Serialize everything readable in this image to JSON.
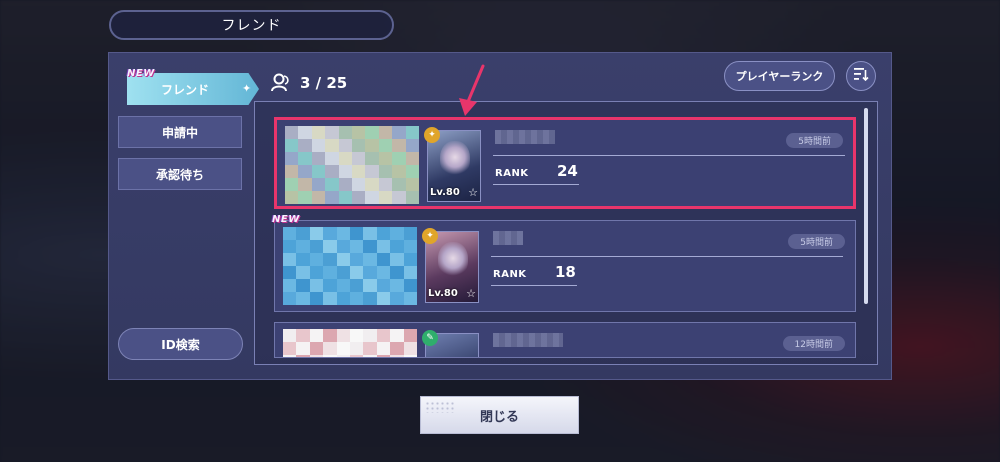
{
  "header": {
    "title": "フレンド"
  },
  "tabs": {
    "friend": "フレンド",
    "new_badge": "NEW"
  },
  "sidebar": {
    "pending": "申請中",
    "awaiting": "承認待ち",
    "id_search": "ID検索"
  },
  "count": {
    "text": "3 / 25"
  },
  "toolbar": {
    "player_rank": "プレイヤーランク",
    "sort_icon": "sort-icon"
  },
  "friends": [
    {
      "level": "Lv.80",
      "rank_label": "RANK",
      "rank": "24",
      "last_login": "5時間前",
      "is_new": false,
      "badge_color": "#e0a52a",
      "highlighted": true
    },
    {
      "level": "Lv.80",
      "rank_label": "RANK",
      "rank": "18",
      "last_login": "5時間前",
      "is_new": true,
      "badge_color": "#e0a52a",
      "highlighted": false
    },
    {
      "level": "",
      "rank_label": "",
      "rank": "",
      "last_login": "12時間前",
      "is_new": false,
      "badge_color": "#2fae6c",
      "highlighted": false
    }
  ],
  "footer": {
    "close": "閉じる"
  },
  "colors": {
    "highlight": "#e8356b",
    "tab": "#8fd3ea",
    "panel": "#383d68"
  }
}
